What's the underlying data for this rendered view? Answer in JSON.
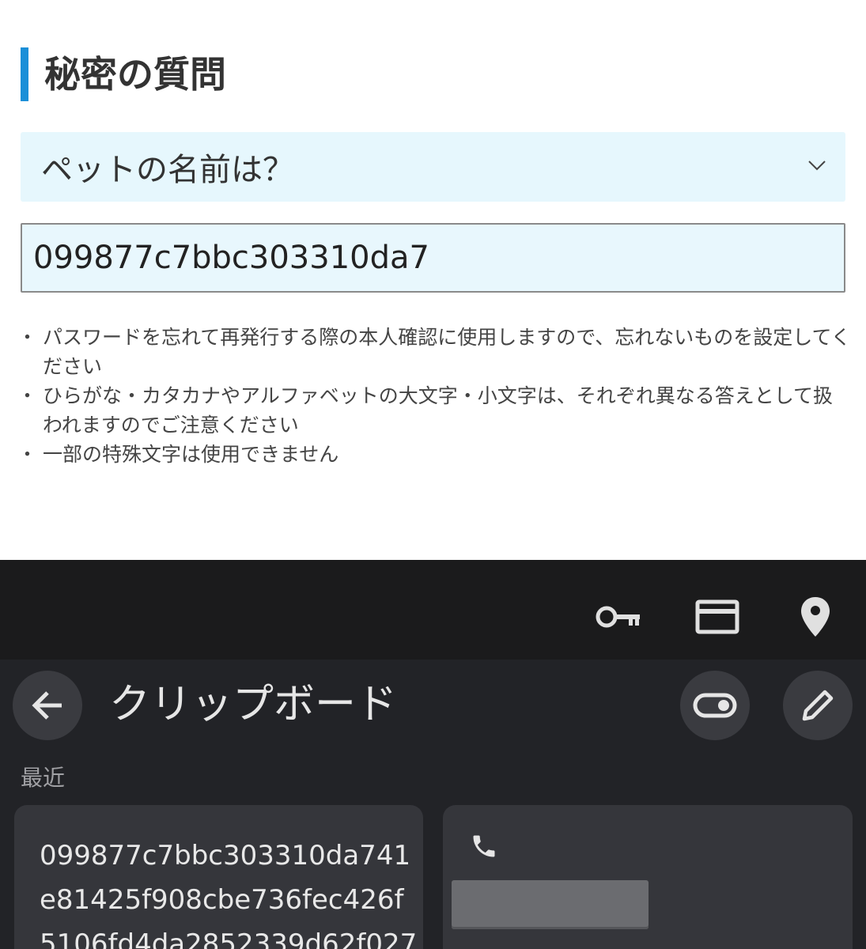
{
  "form": {
    "section_title": "秘密の質問",
    "question_selected": "ペットの名前は？",
    "answer_value": "099877c7bbc303310da7",
    "notes": [
      "パスワードを忘れて再発行する際の本人確認に使用しますので、忘れないものを設定してください",
      "ひらがな・カタカナやアルファベットの大文字・小文字は、それぞれ異なる答えとして扱われますのでご注意ください",
      "一部の特殊文字は使用できません"
    ]
  },
  "keyboard": {
    "toolbar_icons": [
      "key-icon",
      "credit-card-icon",
      "location-pin-icon"
    ],
    "clipboard": {
      "title": "クリップボード",
      "recent_label": "最近",
      "items": [
        {
          "type": "text",
          "lines": [
            "099877c7bbc303310da741",
            "e81425f908cbe736fec426f",
            "5106fd4da2852339d62f027"
          ]
        },
        {
          "type": "phone",
          "icon": "phone-icon"
        }
      ]
    }
  },
  "colors": {
    "title_accent": "#1a8fd8",
    "field_background": "#e6f7fd",
    "keyboard_toolbar": "#1b1b1c",
    "keyboard_panel": "#222327",
    "clip_card": "#35363b"
  }
}
